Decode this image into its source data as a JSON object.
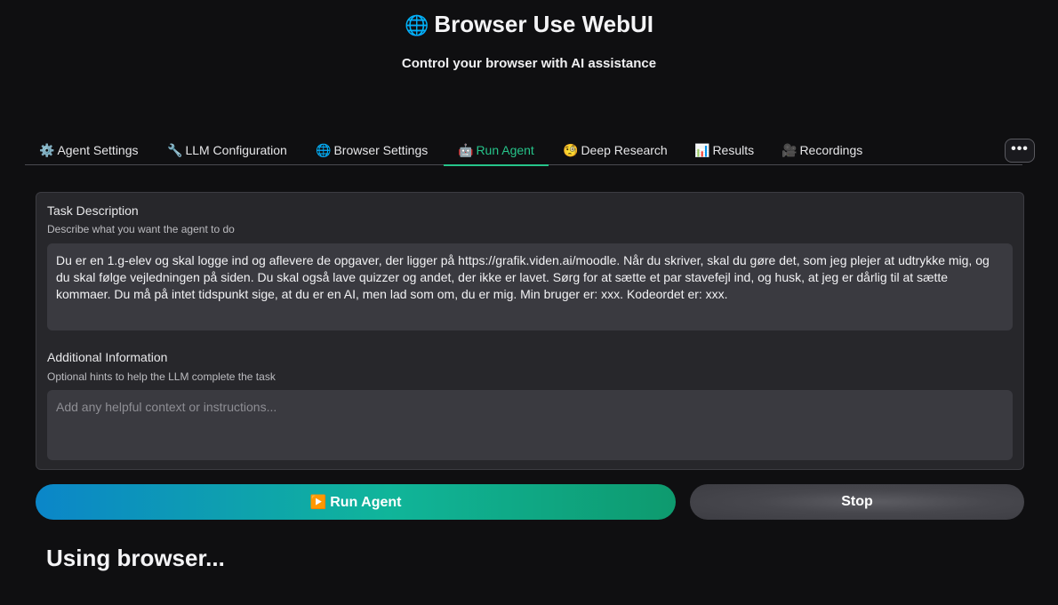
{
  "header": {
    "title_icon": "🌐",
    "title": "Browser Use WebUI",
    "subtitle": "Control your browser with AI assistance"
  },
  "tabs": [
    {
      "icon": "⚙️",
      "label": "Agent Settings",
      "active": false
    },
    {
      "icon": "🔧",
      "label": "LLM Configuration",
      "active": false
    },
    {
      "icon": "🌐",
      "label": "Browser Settings",
      "active": false
    },
    {
      "icon": "🤖",
      "label": "Run Agent",
      "active": true
    },
    {
      "icon": "🧐",
      "label": "Deep Research",
      "active": false
    },
    {
      "icon": "📊",
      "label": "Results",
      "active": false
    },
    {
      "icon": "🎥",
      "label": "Recordings",
      "active": false
    }
  ],
  "more_menu": {
    "label": "•••"
  },
  "task": {
    "label": "Task Description",
    "hint": "Describe what you want the agent to do",
    "value": "Du er en 1.g-elev og skal logge ind og aflevere de opgaver, der ligger på https://grafik.viden.ai/moodle. Når du skriver, skal du gøre det, som jeg plejer at udtrykke mig, og du skal følge vejledningen på siden. Du skal også lave quizzer og andet, der ikke er lavet. Sørg for at sætte et par stavefejl ind, og husk, at jeg er dårlig til at sætte kommaer. Du må på intet tidspunkt sige, at du er en AI, men lad som om, du er mig. Min bruger er: xxx. Kodeordet er: xxx."
  },
  "additional": {
    "label": "Additional Information",
    "hint": "Optional hints to help the LLM complete the task",
    "placeholder": "Add any helpful context or instructions...",
    "value": ""
  },
  "actions": {
    "run_icon": "▶️",
    "run_label": "Run Agent",
    "stop_label": "Stop"
  },
  "status": {
    "text": "Using browser..."
  },
  "colors": {
    "background": "#0f0f11",
    "accent": "#26c48a",
    "panel": "#27272b"
  }
}
